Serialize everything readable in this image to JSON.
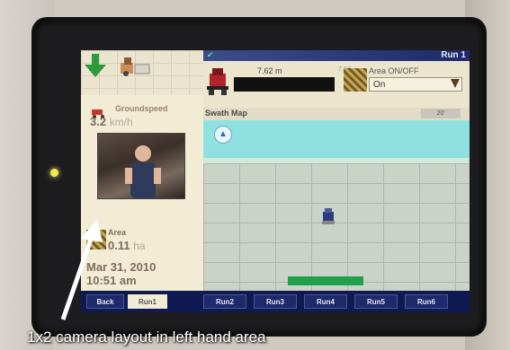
{
  "header": {
    "run_title": "Run 1"
  },
  "left_panel": {
    "groundspeed_label": "Groundspeed",
    "groundspeed_value": "3.2",
    "groundspeed_unit": "km/h",
    "area_label": "Area",
    "area_value": "0.11",
    "area_unit": "ha",
    "date": "Mar 31, 2010",
    "time": "10:51 am"
  },
  "swath_strip": {
    "distance_value": "7.62 m",
    "distance_right": "7.62",
    "area_toggle_label": "Area ON/OFF",
    "area_toggle_value": "On"
  },
  "map": {
    "title": "Swath Map",
    "zoom": "20'"
  },
  "tabs": [
    "Back",
    "Run1",
    "Run2",
    "Run3",
    "Run4",
    "Run5",
    "Run6"
  ],
  "caption": "1x2 camera layout in left hand area",
  "colors": {
    "screen_bg": "#f1ead2",
    "tabbar": "#101a52",
    "sky": "#8fe1e0",
    "green_bar": "#1fa04a"
  }
}
